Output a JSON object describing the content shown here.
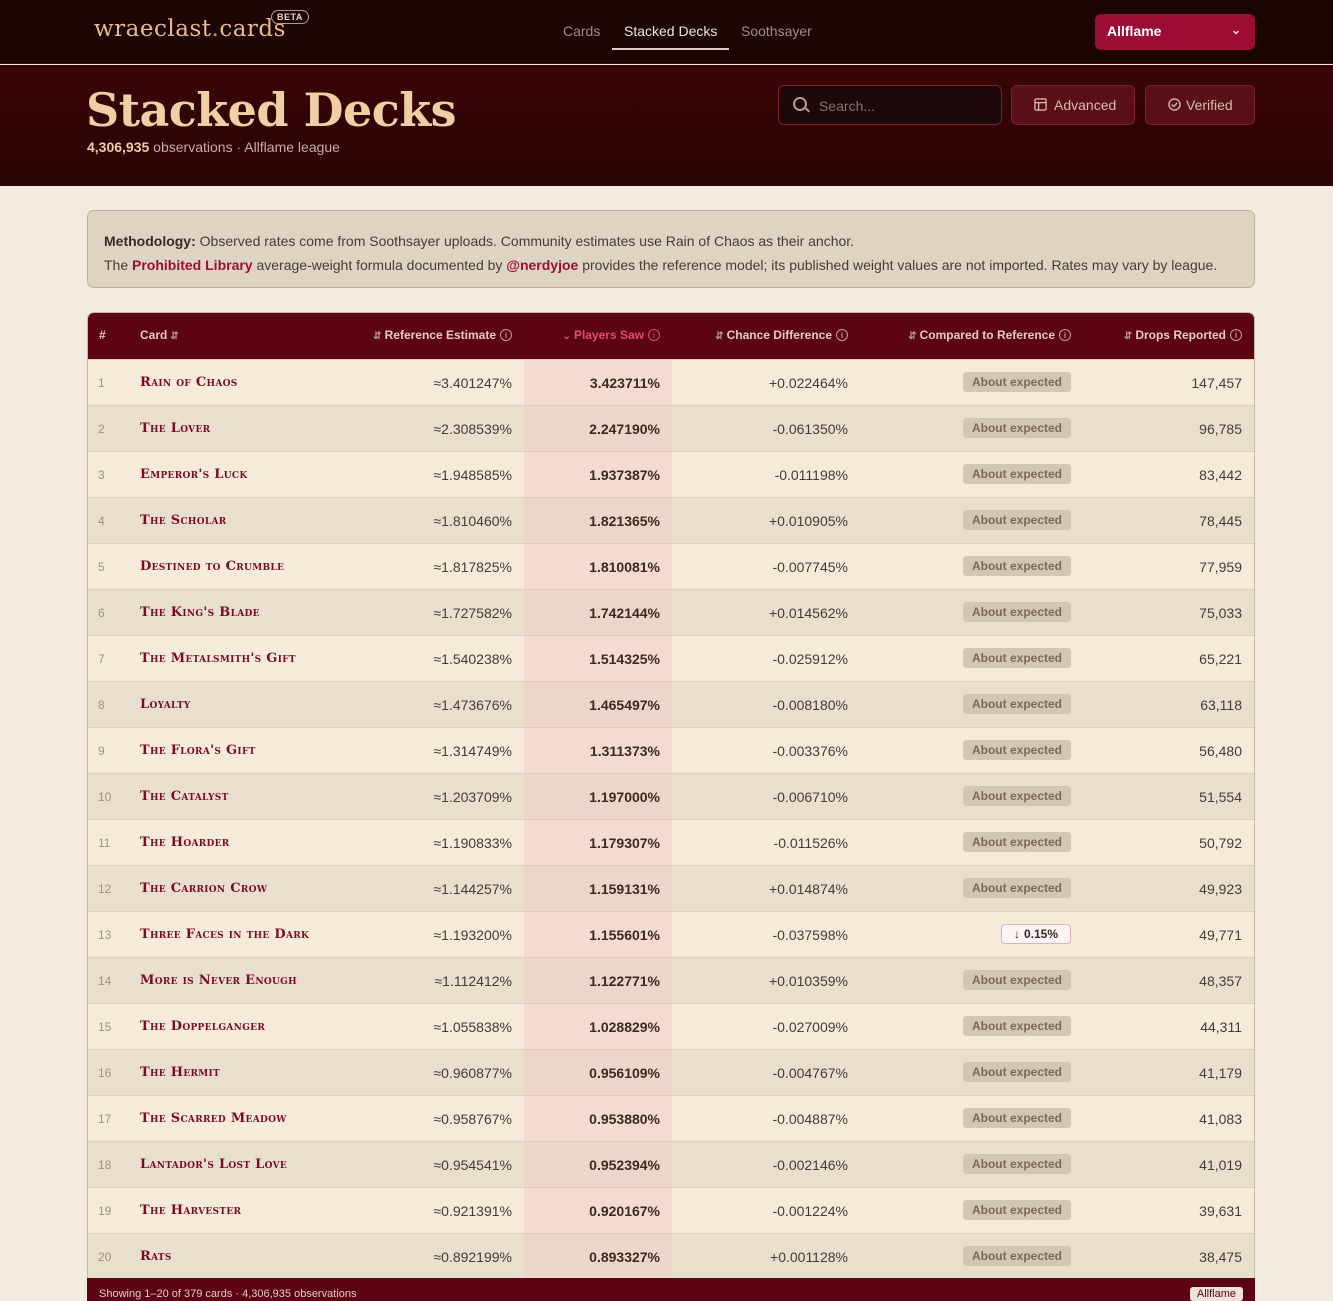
{
  "brand": {
    "name_a": "wraeclast",
    "dot": ".",
    "name_b": "cards",
    "badge": "BETA"
  },
  "nav": {
    "cards": "Cards",
    "stacked": "Stacked Decks",
    "soothsayer": "Soothsayer",
    "league": "Allflame"
  },
  "hero": {
    "title": "Stacked Decks",
    "observations": "4,306,935",
    "observations_suffix": " observations · Allflame league",
    "search_placeholder": "Search...",
    "advanced": "Advanced",
    "verified": "Verified"
  },
  "methodology": {
    "label": "Methodology:",
    "line1": " Observed rates come from Soothsayer uploads. Community estimates use Rain of Chaos as their anchor.",
    "line2_a": "The ",
    "link1": "Prohibited Library",
    "line2_b": " average-weight formula documented by ",
    "link2": "@nerdyjoe",
    "line2_c": " provides the reference model; its published weight values are not imported. Rates may vary by league."
  },
  "table": {
    "headers": {
      "num": "#",
      "card": "Card",
      "ref": "Reference Estimate",
      "players": "Players Saw",
      "diff": "Chance Difference",
      "cmp": "Compared to Reference",
      "drops": "Drops Reported"
    },
    "rows": [
      {
        "n": "1",
        "card": "Rain of Chaos",
        "ref": "≈3.401247%",
        "players": "3.423711%",
        "diff": "+0.022464%",
        "cmp": "About expected",
        "drops": "147,457"
      },
      {
        "n": "2",
        "card": "The Lover",
        "ref": "≈2.308539%",
        "players": "2.247190%",
        "diff": "-0.061350%",
        "cmp": "About expected",
        "drops": "96,785"
      },
      {
        "n": "3",
        "card": "Emperor's Luck",
        "ref": "≈1.948585%",
        "players": "1.937387%",
        "diff": "-0.011198%",
        "cmp": "About expected",
        "drops": "83,442"
      },
      {
        "n": "4",
        "card": "The Scholar",
        "ref": "≈1.810460%",
        "players": "1.821365%",
        "diff": "+0.010905%",
        "cmp": "About expected",
        "drops": "78,445"
      },
      {
        "n": "5",
        "card": "Destined to Crumble",
        "ref": "≈1.817825%",
        "players": "1.810081%",
        "diff": "-0.007745%",
        "cmp": "About expected",
        "drops": "77,959"
      },
      {
        "n": "6",
        "card": "The King's Blade",
        "ref": "≈1.727582%",
        "players": "1.742144%",
        "diff": "+0.014562%",
        "cmp": "About expected",
        "drops": "75,033"
      },
      {
        "n": "7",
        "card": "The Metalsmith's Gift",
        "ref": "≈1.540238%",
        "players": "1.514325%",
        "diff": "-0.025912%",
        "cmp": "About expected",
        "drops": "65,221"
      },
      {
        "n": "8",
        "card": "Loyalty",
        "ref": "≈1.473676%",
        "players": "1.465497%",
        "diff": "-0.008180%",
        "cmp": "About expected",
        "drops": "63,118"
      },
      {
        "n": "9",
        "card": "The Flora's Gift",
        "ref": "≈1.314749%",
        "players": "1.311373%",
        "diff": "-0.003376%",
        "cmp": "About expected",
        "drops": "56,480"
      },
      {
        "n": "10",
        "card": "The Catalyst",
        "ref": "≈1.203709%",
        "players": "1.197000%",
        "diff": "-0.006710%",
        "cmp": "About expected",
        "drops": "51,554"
      },
      {
        "n": "11",
        "card": "The Hoarder",
        "ref": "≈1.190833%",
        "players": "1.179307%",
        "diff": "-0.011526%",
        "cmp": "About expected",
        "drops": "50,792"
      },
      {
        "n": "12",
        "card": "The Carrion Crow",
        "ref": "≈1.144257%",
        "players": "1.159131%",
        "diff": "+0.014874%",
        "cmp": "About expected",
        "drops": "49,923"
      },
      {
        "n": "13",
        "card": "Three Faces in the Dark",
        "ref": "≈1.193200%",
        "players": "1.155601%",
        "diff": "-0.037598%",
        "cmp": "0.15%",
        "cmp_down": true,
        "drops": "49,771"
      },
      {
        "n": "14",
        "card": "More is Never Enough",
        "ref": "≈1.112412%",
        "players": "1.122771%",
        "diff": "+0.010359%",
        "cmp": "About expected",
        "drops": "48,357"
      },
      {
        "n": "15",
        "card": "The Doppelganger",
        "ref": "≈1.055838%",
        "players": "1.028829%",
        "diff": "-0.027009%",
        "cmp": "About expected",
        "drops": "44,311"
      },
      {
        "n": "16",
        "card": "The Hermit",
        "ref": "≈0.960877%",
        "players": "0.956109%",
        "diff": "-0.004767%",
        "cmp": "About expected",
        "drops": "41,179"
      },
      {
        "n": "17",
        "card": "The Scarred Meadow",
        "ref": "≈0.958767%",
        "players": "0.953880%",
        "diff": "-0.004887%",
        "cmp": "About expected",
        "drops": "41,083"
      },
      {
        "n": "18",
        "card": "Lantador's Lost Love",
        "ref": "≈0.954541%",
        "players": "0.952394%",
        "diff": "-0.002146%",
        "cmp": "About expected",
        "drops": "41,019"
      },
      {
        "n": "19",
        "card": "The Harvester",
        "ref": "≈0.921391%",
        "players": "0.920167%",
        "diff": "-0.001224%",
        "cmp": "About expected",
        "drops": "39,631"
      },
      {
        "n": "20",
        "card": "Rats",
        "ref": "≈0.892199%",
        "players": "0.893327%",
        "diff": "+0.001128%",
        "cmp": "About expected",
        "drops": "38,475"
      }
    ]
  },
  "footer": {
    "summary": "Showing 1–20 of 379 cards · 4,306,935 observations",
    "tag": "Allflame"
  }
}
